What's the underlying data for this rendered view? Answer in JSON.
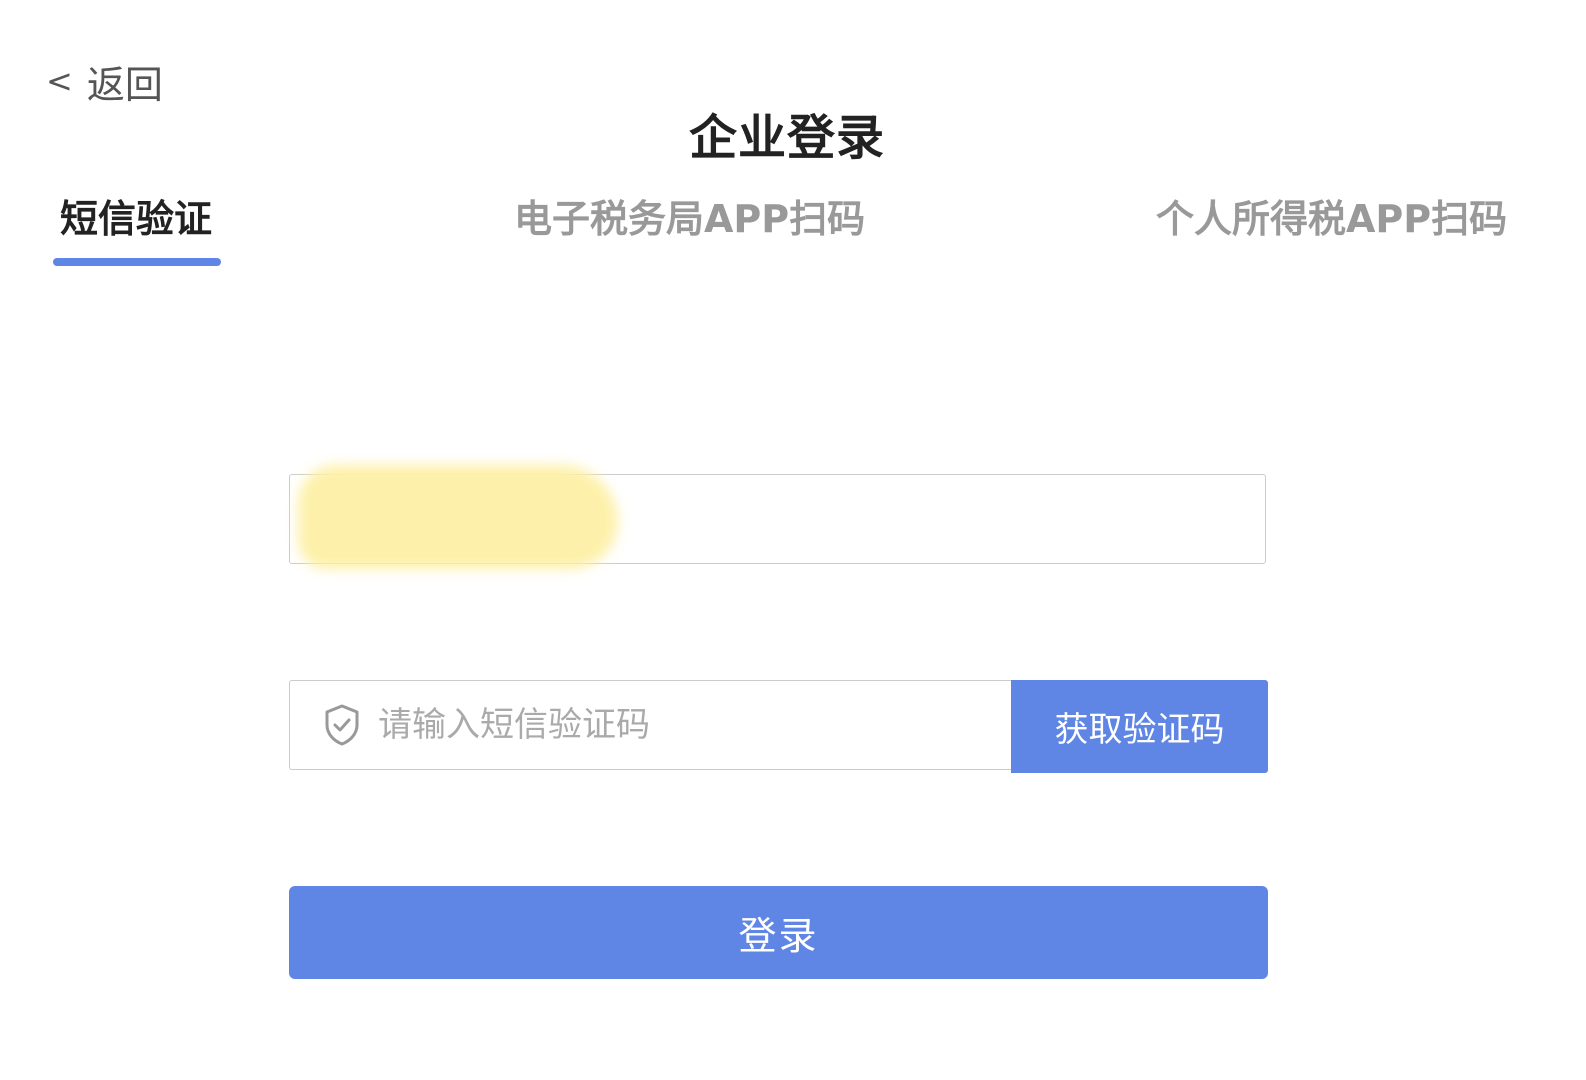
{
  "nav": {
    "back_chevron": "<",
    "back_label": "返回"
  },
  "page": {
    "title": "企业登录"
  },
  "tabs": [
    {
      "label": "短信验证",
      "active": true
    },
    {
      "label": "电子税务局APP扫码",
      "active": false
    },
    {
      "label": "个人所得税APP扫码",
      "active": false
    }
  ],
  "form": {
    "phone": {
      "value": "",
      "redacted": true
    },
    "code": {
      "value": "",
      "placeholder": "请输入短信验证码",
      "icon": "shield-check-icon"
    },
    "get_code_label": "获取验证码",
    "login_label": "登录"
  },
  "colors": {
    "accent": "#6086e5",
    "active_text": "#222222",
    "inactive_text": "#999999",
    "placeholder": "#aaaaaa",
    "redaction": "#fdf0a6"
  }
}
